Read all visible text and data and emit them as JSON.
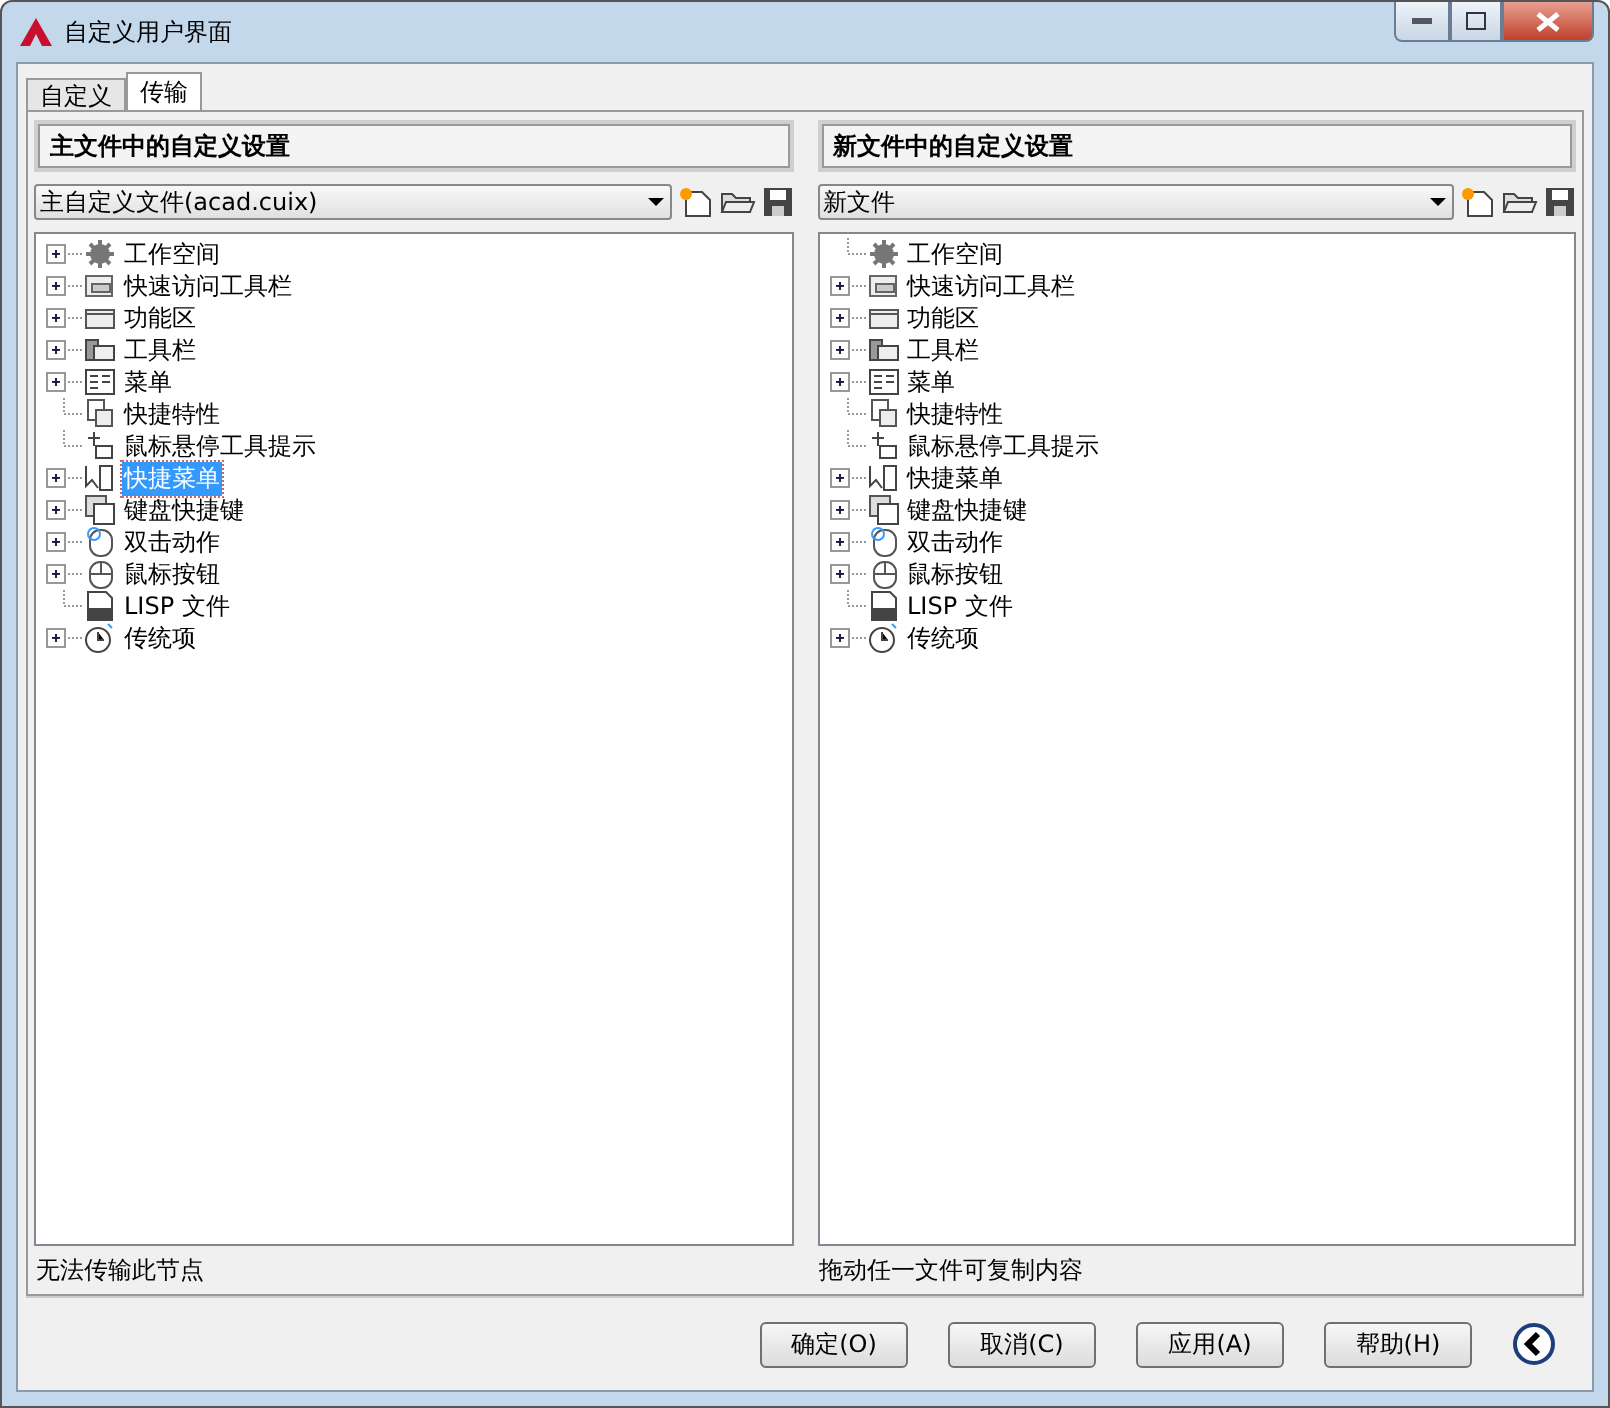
{
  "window": {
    "title": "自定义用户界面"
  },
  "tabs": [
    {
      "label": "自定义",
      "selected": false
    },
    {
      "label": "传输",
      "selected": true
    }
  ],
  "panels": [
    {
      "heading": "主文件中的自定义设置",
      "file": "主自定义文件(acad.cuix)",
      "status": "无法传输此节点",
      "tree": [
        {
          "label": "工作空间",
          "kind": "workspace",
          "expandable": true,
          "selected": false
        },
        {
          "label": "快速访问工具栏",
          "kind": "quickbar",
          "expandable": true,
          "selected": false
        },
        {
          "label": "功能区",
          "kind": "ribbon",
          "expandable": true,
          "selected": false
        },
        {
          "label": "工具栏",
          "kind": "toolbar",
          "expandable": true,
          "selected": false
        },
        {
          "label": "菜单",
          "kind": "menu",
          "expandable": true,
          "selected": false
        },
        {
          "label": "快捷特性",
          "kind": "props",
          "expandable": false,
          "selected": false
        },
        {
          "label": "鼠标悬停工具提示",
          "kind": "tooltip",
          "expandable": false,
          "selected": false
        },
        {
          "label": "快捷菜单",
          "kind": "context",
          "expandable": true,
          "selected": true
        },
        {
          "label": "键盘快捷键",
          "kind": "keyboard",
          "expandable": true,
          "selected": false
        },
        {
          "label": "双击动作",
          "kind": "dblclick",
          "expandable": true,
          "selected": false
        },
        {
          "label": "鼠标按钮",
          "kind": "mouse",
          "expandable": true,
          "selected": false
        },
        {
          "label": "LISP 文件",
          "kind": "lisp",
          "expandable": false,
          "selected": false
        },
        {
          "label": "传统项",
          "kind": "legacy",
          "expandable": true,
          "selected": false
        }
      ]
    },
    {
      "heading": "新文件中的自定义设置",
      "file": "新文件",
      "status": "拖动任一文件可复制内容",
      "tree": [
        {
          "label": "工作空间",
          "kind": "workspace",
          "expandable": false,
          "selected": false
        },
        {
          "label": "快速访问工具栏",
          "kind": "quickbar",
          "expandable": true,
          "selected": false
        },
        {
          "label": "功能区",
          "kind": "ribbon",
          "expandable": true,
          "selected": false
        },
        {
          "label": "工具栏",
          "kind": "toolbar",
          "expandable": true,
          "selected": false
        },
        {
          "label": "菜单",
          "kind": "menu",
          "expandable": true,
          "selected": false
        },
        {
          "label": "快捷特性",
          "kind": "props",
          "expandable": false,
          "selected": false
        },
        {
          "label": "鼠标悬停工具提示",
          "kind": "tooltip",
          "expandable": false,
          "selected": false
        },
        {
          "label": "快捷菜单",
          "kind": "context",
          "expandable": true,
          "selected": false
        },
        {
          "label": "键盘快捷键",
          "kind": "keyboard",
          "expandable": true,
          "selected": false
        },
        {
          "label": "双击动作",
          "kind": "dblclick",
          "expandable": true,
          "selected": false
        },
        {
          "label": "鼠标按钮",
          "kind": "mouse",
          "expandable": true,
          "selected": false
        },
        {
          "label": "LISP 文件",
          "kind": "lisp",
          "expandable": false,
          "selected": false
        },
        {
          "label": "传统项",
          "kind": "legacy",
          "expandable": true,
          "selected": false
        }
      ]
    }
  ],
  "buttons": [
    "确定(O)",
    "取消(C)",
    "应用(A)",
    "帮助(H)"
  ]
}
